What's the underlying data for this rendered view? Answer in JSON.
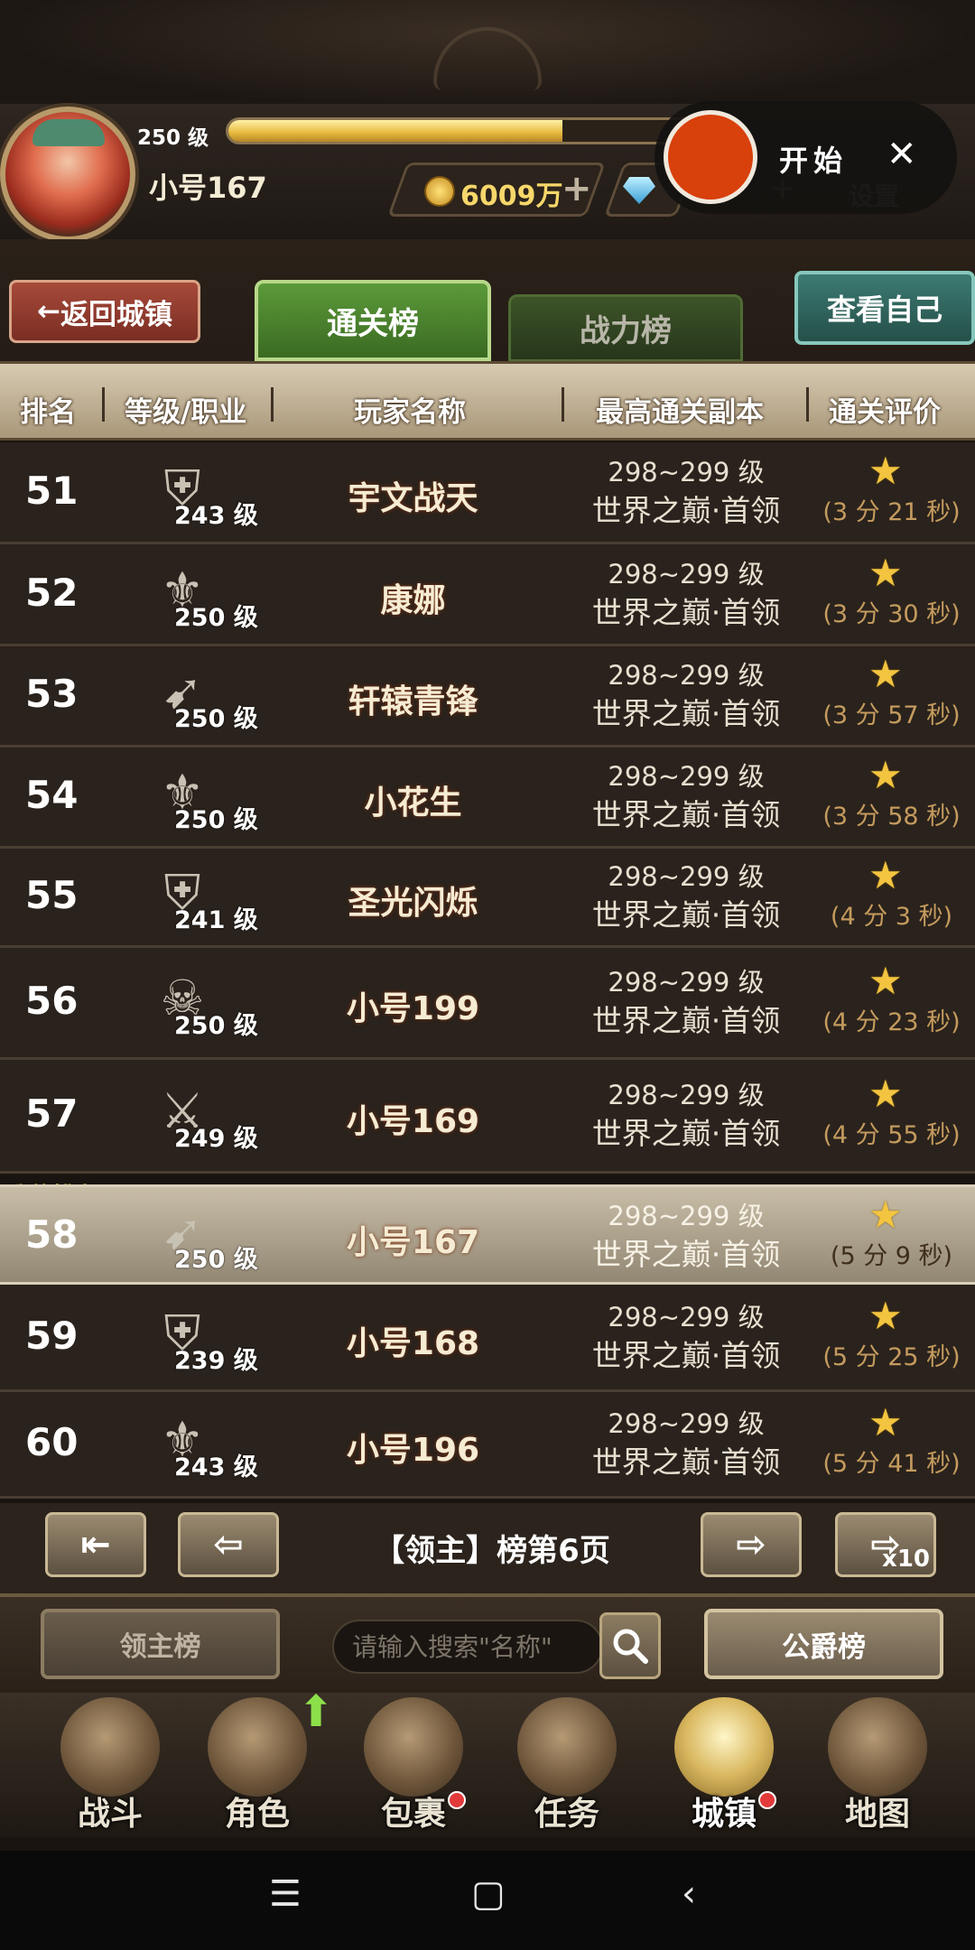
{
  "header": {
    "level": "250 级",
    "xp_fraction": 0.72,
    "player_name": "小号167",
    "gold": "6009万",
    "settings_label": "设置"
  },
  "recorder": {
    "start_label": "开始",
    "close_glyph": "✕"
  },
  "tabs": {
    "back_label": "返回城镇",
    "back_glyph": "←",
    "active": "通关榜",
    "inactive": "战力榜",
    "view_self": "查看自己"
  },
  "columns": [
    "排名",
    "等级/职业",
    "玩家名称",
    "最高通关副本",
    "通关评价"
  ],
  "rows": [
    {
      "rank": "51",
      "cls": "shield",
      "level": "243 级",
      "name": "宇文战天",
      "dungeon_level": "298~299 级",
      "dungeon": "世界之巅·首领",
      "time": "(3 分 21 秒)"
    },
    {
      "rank": "52",
      "cls": "drop",
      "level": "250 级",
      "name": "康娜",
      "dungeon_level": "298~299 级",
      "dungeon": "世界之巅·首领",
      "time": "(3 分 30 秒)"
    },
    {
      "rank": "53",
      "cls": "bow",
      "level": "250 级",
      "name": "轩辕青锋",
      "dungeon_level": "298~299 级",
      "dungeon": "世界之巅·首领",
      "time": "(3 分 57 秒)"
    },
    {
      "rank": "54",
      "cls": "drop",
      "level": "250 级",
      "name": "小花生",
      "dungeon_level": "298~299 级",
      "dungeon": "世界之巅·首领",
      "time": "(3 分 58 秒)"
    },
    {
      "rank": "55",
      "cls": "shield",
      "level": "241 级",
      "name": "圣光闪烁",
      "dungeon_level": "298~299 级",
      "dungeon": "世界之巅·首领",
      "time": "(4 分 3 秒)"
    },
    {
      "rank": "56",
      "cls": "skull",
      "level": "250 级",
      "name": "小号199",
      "dungeon_level": "298~299 级",
      "dungeon": "世界之巅·首领",
      "time": "(4 分 23 秒)"
    },
    {
      "rank": "57",
      "cls": "blade",
      "level": "249 级",
      "name": "小号169",
      "dungeon_level": "298~299 级",
      "dungeon": "世界之巅·首领",
      "time": "(4 分 55 秒)"
    },
    {
      "rank": "58",
      "cls": "bow",
      "level": "250 级",
      "name": "小号167",
      "dungeon_level": "298~299 级",
      "dungeon": "世界之巅·首领",
      "time": "(5 分 9 秒)",
      "mine": true
    },
    {
      "rank": "59",
      "cls": "shield",
      "level": "239 级",
      "name": "小号168",
      "dungeon_level": "298~299 级",
      "dungeon": "世界之巅·首领",
      "time": "(5 分 25 秒)"
    },
    {
      "rank": "60",
      "cls": "drop",
      "level": "243 级",
      "name": "小号196",
      "dungeon_level": "298~299 级",
      "dungeon": "世界之巅·首领",
      "time": "(5 分 41 秒)"
    }
  ],
  "my_rank_tag": "我的排名",
  "pager": {
    "label": "【领主】榜第6页",
    "x10": "x10"
  },
  "search": {
    "lord_button": "领主榜",
    "placeholder": "请输入搜索\"名称\"",
    "duke_button": "公爵榜"
  },
  "nav": [
    "战斗",
    "角色",
    "包裹",
    "任务",
    "城镇",
    "地图"
  ],
  "active_nav": "城镇",
  "sysnav": {
    "menu": "☰",
    "home": "▢",
    "back": "‹"
  },
  "colors": {
    "accent_gold": "#f3c43f",
    "active_tab": "#5c9a3a",
    "record_red": "#d8400c"
  }
}
